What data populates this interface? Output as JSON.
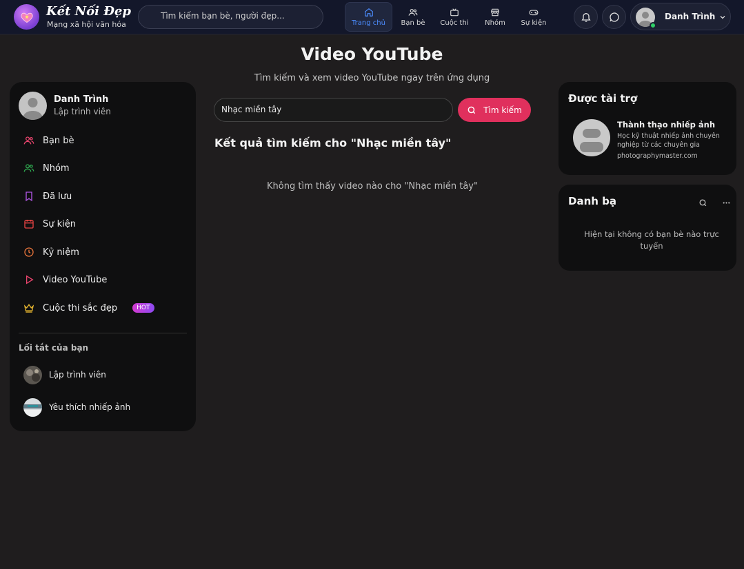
{
  "header": {
    "brand_title": "Kết Nối Đẹp",
    "brand_subtitle": "Mạng xã hội văn hóa",
    "search_placeholder": "Tìm kiếm bạn bè, người đẹp...",
    "nav": [
      {
        "label": "Trang chủ",
        "icon": "home-icon",
        "active": true
      },
      {
        "label": "Bạn bè",
        "icon": "users-icon",
        "active": false
      },
      {
        "label": "Cuộc thi",
        "icon": "tv-icon",
        "active": false
      },
      {
        "label": "Nhóm",
        "icon": "store-icon",
        "active": false
      },
      {
        "label": "Sự kiện",
        "icon": "gamepad-icon",
        "active": false
      }
    ],
    "user_name": "Danh Trình",
    "accent_color": "#4c8dff"
  },
  "page": {
    "title": "Video YouTube",
    "subtitle": "Tìm kiếm và xem video YouTube ngay trên ứng dụng"
  },
  "sidebar": {
    "profile_name": "Danh Trình",
    "profile_role": "Lập trình viên",
    "menu": [
      {
        "label": "Bạn bè",
        "icon": "users-icon",
        "color": "#e8446d"
      },
      {
        "label": "Nhóm",
        "icon": "group-icon",
        "color": "#2fa84f"
      },
      {
        "label": "Đã lưu",
        "icon": "bookmark-icon",
        "color": "#b257e8"
      },
      {
        "label": "Sự kiện",
        "icon": "calendar-icon",
        "color": "#e84343"
      },
      {
        "label": "Kỷ niệm",
        "icon": "clock-icon",
        "color": "#e8743b"
      },
      {
        "label": "Video YouTube",
        "icon": "play-icon",
        "color": "#e8446d"
      },
      {
        "label": "Cuộc thi sắc đẹp",
        "icon": "crown-icon",
        "color": "#e8b730",
        "badge": "HOT"
      }
    ],
    "shortcuts_title": "Lối tắt của bạn",
    "shortcuts": [
      {
        "label": "Lập trình viên"
      },
      {
        "label": "Yêu thích nhiếp ảnh"
      }
    ]
  },
  "main": {
    "search_value": "Nhạc miền tây",
    "search_button": "Tìm kiếm",
    "results_title": "Kết quả tìm kiếm cho \"Nhạc miền tây\"",
    "no_results": "Không tìm thấy video nào cho \"Nhạc miền tây\"",
    "button_color": "#e0305d"
  },
  "sponsored": {
    "title": "Được tài trợ",
    "ad_title": "Thành thạo nhiếp ảnh",
    "ad_desc": "Học kỹ thuật nhiếp ảnh chuyên nghiệp từ các chuyên gia",
    "ad_url": "photographymaster.com"
  },
  "contacts": {
    "title": "Danh bạ",
    "empty_text": "Hiện tại không có bạn bè nào trực tuyến"
  }
}
